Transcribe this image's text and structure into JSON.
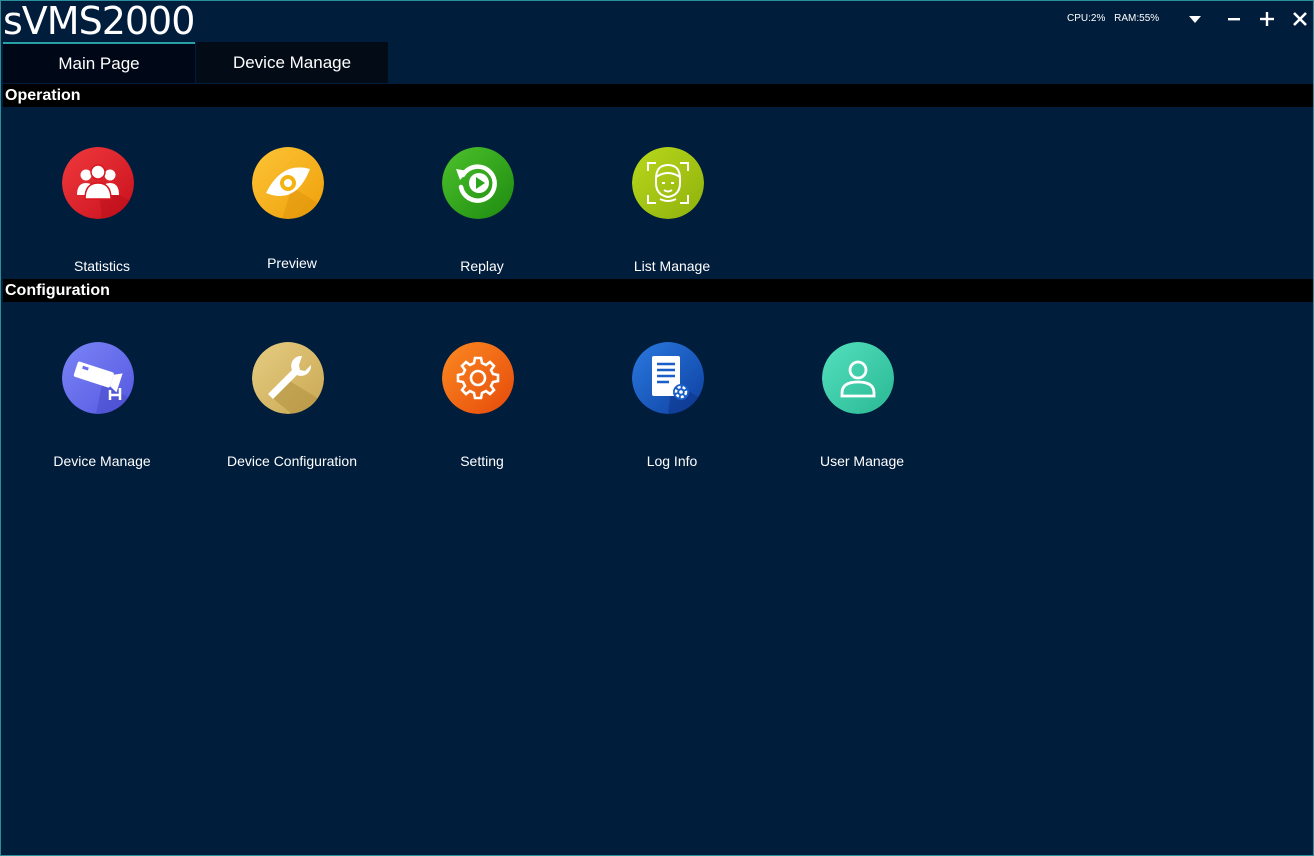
{
  "window": {
    "title": "sVMS2000",
    "cpu": "CPU:2%",
    "ram": "RAM:55%"
  },
  "tabs": [
    {
      "label": "Main Page"
    },
    {
      "label": "Device Manage"
    }
  ],
  "sections": {
    "operation": {
      "title": "Operation",
      "items": [
        {
          "label": "Statistics",
          "icon": "users-icon",
          "color": "#e8242a"
        },
        {
          "label": "Preview",
          "icon": "eye-icon",
          "color": "#f4b311"
        },
        {
          "label": "Replay",
          "icon": "replay-icon",
          "color": "#2aa51c"
        },
        {
          "label": "List Manage",
          "icon": "face-scan-icon",
          "color": "#a8c514"
        }
      ]
    },
    "configuration": {
      "title": "Configuration",
      "items": [
        {
          "label": "Device Manage",
          "icon": "camera-icon",
          "color": "#6a6ef0"
        },
        {
          "label": "Device Configuration",
          "icon": "wrench-icon",
          "color": "#d7bb6b"
        },
        {
          "label": "Setting",
          "icon": "gear-icon",
          "color": "#f36a14"
        },
        {
          "label": "Log Info",
          "icon": "document-settings-icon",
          "color": "#1a5fc8"
        },
        {
          "label": "User Manage",
          "icon": "user-icon",
          "color": "#3fd0a8"
        }
      ]
    }
  }
}
